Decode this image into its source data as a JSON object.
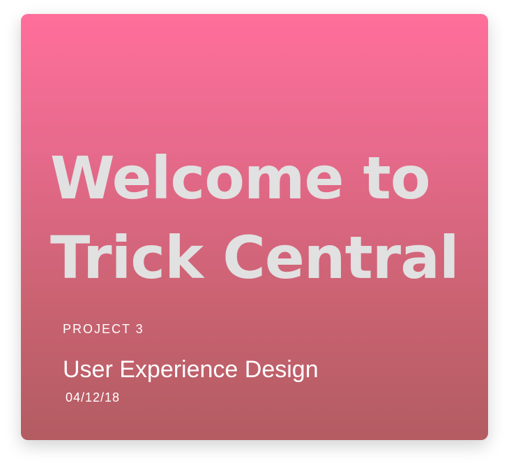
{
  "card": {
    "headline": "Welcome to\nTrick Central",
    "project_label": "PROJECT 3",
    "title": "User Experience Design",
    "date": "04/12/18"
  },
  "colors": {
    "gradient_top": "#ff6f9b",
    "gradient_bottom": "#b35c62",
    "headline": "#e1e1e1",
    "text": "#ffffff"
  }
}
